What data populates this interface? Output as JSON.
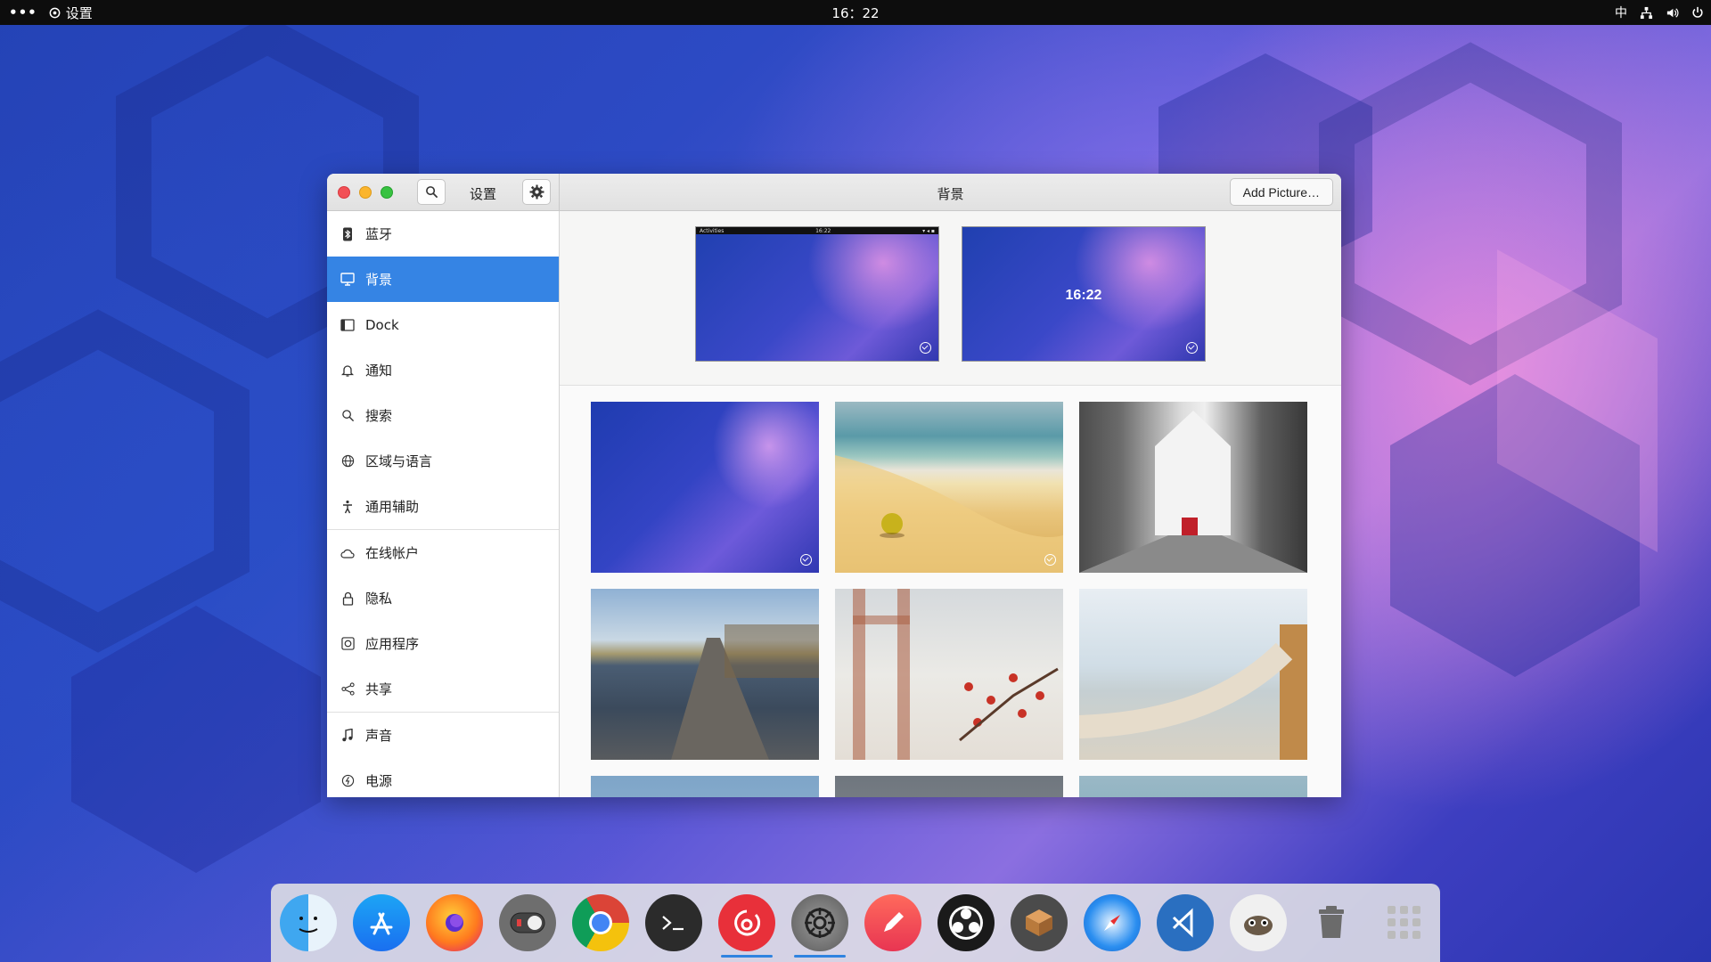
{
  "topbar": {
    "activities": "•••",
    "app_name": "设置",
    "clock": "16：22",
    "input_method": "中"
  },
  "window": {
    "sidebar_title": "设置",
    "page_title": "背景",
    "add_picture_label": "Add Picture…"
  },
  "sidebar": {
    "items": [
      {
        "label": "蓝牙",
        "icon": "bluetooth-icon"
      },
      {
        "label": "背景",
        "icon": "display-icon",
        "active": true
      },
      {
        "label": "Dock",
        "icon": "dock-icon"
      },
      {
        "label": "通知",
        "icon": "bell-icon"
      },
      {
        "label": "搜索",
        "icon": "search-icon"
      },
      {
        "label": "区域与语言",
        "icon": "globe-icon"
      },
      {
        "label": "通用辅助",
        "icon": "accessibility-icon"
      },
      {
        "label": "在线帐户",
        "icon": "cloud-icon"
      },
      {
        "label": "隐私",
        "icon": "lock-icon"
      },
      {
        "label": "应用程序",
        "icon": "apps-icon"
      },
      {
        "label": "共享",
        "icon": "share-icon"
      },
      {
        "label": "声音",
        "icon": "music-icon"
      },
      {
        "label": "电源",
        "icon": "power-icon"
      }
    ]
  },
  "previews": {
    "desktop": {
      "topbar_left": "Activities",
      "topbar_clock": "16:22"
    },
    "lock": {
      "clock": "16:22"
    }
  },
  "dock": {
    "apps": [
      "finder-icon",
      "app-store-icon",
      "firefox-icon",
      "toggle-icon",
      "chrome-icon",
      "terminal-icon",
      "netease-music-icon",
      "settings-icon",
      "pencil-icon",
      "obs-icon",
      "package-icon",
      "safari-icon",
      "vscode-icon",
      "gimp-icon",
      "trash-icon",
      "app-grid-icon"
    ],
    "running": [
      "netease-music-icon",
      "settings-icon"
    ]
  }
}
